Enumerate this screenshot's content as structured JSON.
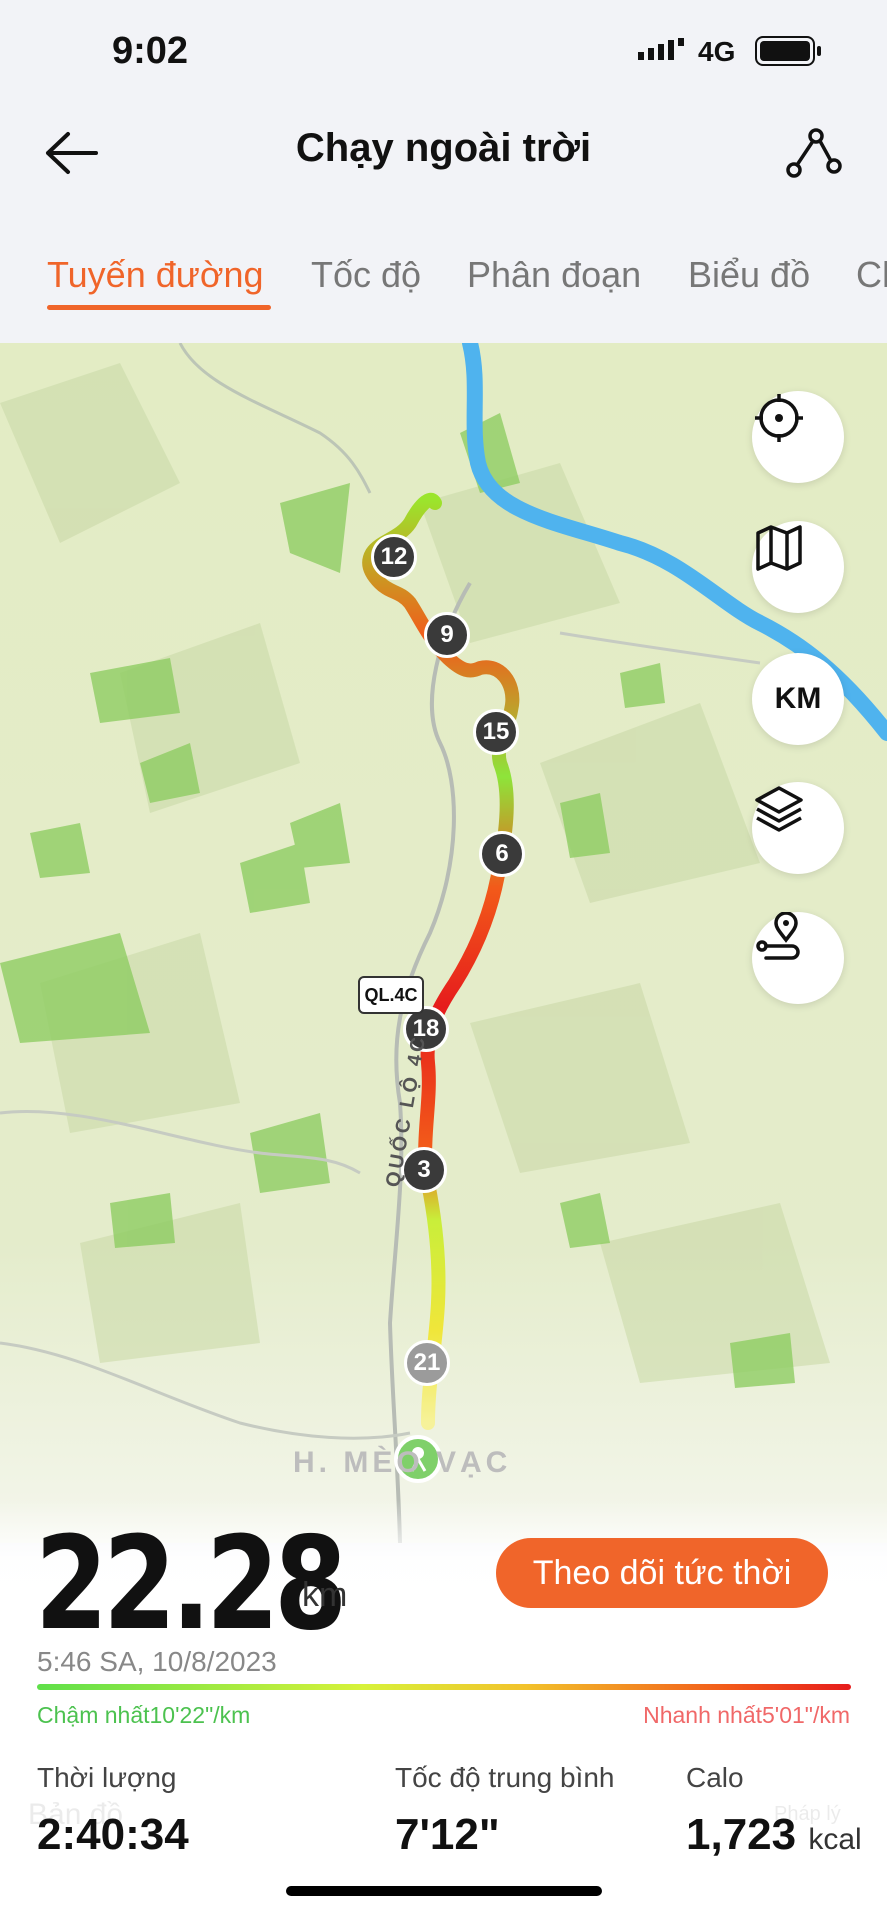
{
  "status_bar": {
    "time": "9:02",
    "network": "4G"
  },
  "header": {
    "title": "Chạy ngoài trời"
  },
  "tabs": [
    {
      "label": "Tuyến đường",
      "active": true
    },
    {
      "label": "Tốc độ",
      "active": false
    },
    {
      "label": "Phân đoạn",
      "active": false
    },
    {
      "label": "Biểu đồ",
      "active": false
    },
    {
      "label": "Ch",
      "active": false
    }
  ],
  "map": {
    "controls": {
      "locate_icon": "crosshair-icon",
      "map_type_icon": "map-icon",
      "km_label": "KM",
      "layers_icon": "layers-icon",
      "route_pin_icon": "route-pin-icon"
    },
    "km_markers": [
      "12",
      "9",
      "15",
      "6",
      "18",
      "3",
      "21"
    ],
    "road_badge": "QL.4C",
    "road_name": "QUỐC LỘ 4C",
    "place_label": "H. MÈO VẠC",
    "watermark_left": "Bản đồ",
    "watermark_right": "Pháp lý"
  },
  "summary": {
    "distance": "22.28",
    "distance_unit": "km",
    "live_button": "Theo dõi tức thời",
    "datetime": "5:46 SA, 10/8/2023",
    "slowest": "Chậm nhất10'22\"/km",
    "fastest": "Nhanh nhất5'01\"/km"
  },
  "stats": {
    "duration": {
      "label": "Thời lượng",
      "value": "2:40:34"
    },
    "avg_pace": {
      "label": "Tốc độ trung bình",
      "value": "7'12\""
    },
    "calories": {
      "label": "Calo",
      "value": "1,723",
      "unit": "kcal"
    }
  },
  "colors": {
    "accent": "#f0652a",
    "slow": "#4cc24f",
    "fast": "#f06868",
    "river": "#4fb3ee"
  }
}
